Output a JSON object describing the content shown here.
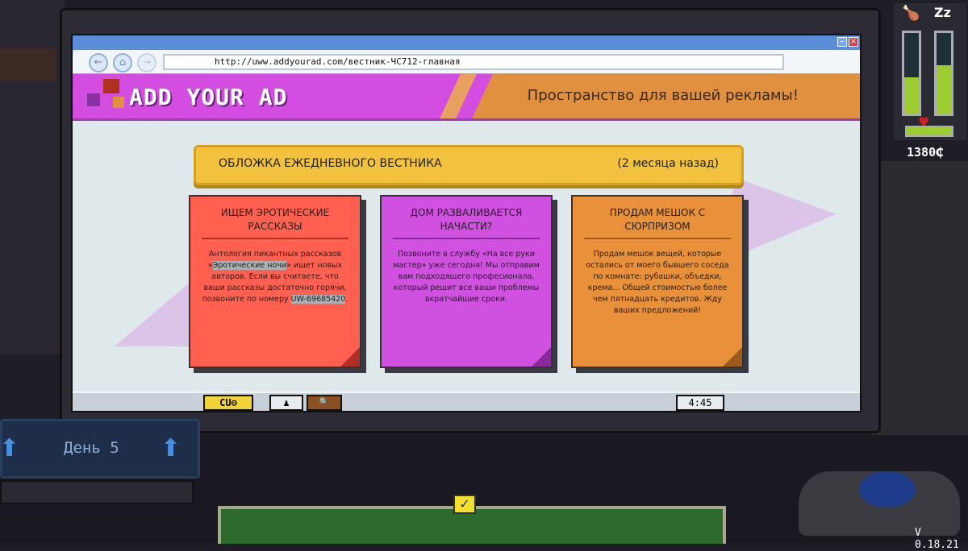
{
  "browser": {
    "url": "http://uww.addyourad.com/вестник-ЧС712-главная",
    "nav": {
      "back": "←",
      "home": "⌂",
      "forward": "→"
    },
    "window_controls": {
      "minimize": "–",
      "close": "×"
    }
  },
  "site": {
    "logo": "ADD YOUR AD",
    "slogan": "Пространство для вашей рекламы!",
    "colors": {
      "magenta": "#d24de0",
      "orange": "#e0903f"
    }
  },
  "banner": {
    "title": "ОБЛОЖКА ЕЖЕДНЕВНОГО ВЕСТНИКА",
    "date": "(2 месяца назад)"
  },
  "ads": [
    {
      "title": "ИЩЕМ ЭРОТИЧЕСКИЕ РАССКАЗЫ",
      "text_before": "Антология пикантных рассказов «",
      "highlight1": "Эротические ночи",
      "text_mid": "» ищет новых авторов. Если вы считаете, что ваши рассказы достаточно горячи, позвоните по номеру ",
      "highlight2": "UW-69685420",
      "text_end": ".",
      "color": "#ff6050"
    },
    {
      "title": "ДОМ РАЗВАЛИВАЕТСЯ НАЧАСТИ?",
      "text": "Позвоните в службу «На все руки мастер» уже сегодня! Мы отправим вам подходящего професионала, который решит все ваши проблемы вкратчайшие сроки.",
      "color": "#d050e0"
    },
    {
      "title": "ПРОДАМ МЕШОК С СЮРПРИЗОМ",
      "text": "Продам мешок вещей, которые остались от моего бывшего соседа по комнате: рубашки, объедки, крема... Общей стоимостью более чем пятнадцать кредитов. Жду ваших предложений!",
      "color": "#e8903a"
    }
  ],
  "taskbar": {
    "start": "CU⊖",
    "app1": "♟",
    "app2": "🔍",
    "clock": "4:45"
  },
  "hud": {
    "day": "День 5",
    "money": "1380₵",
    "version": "V 0.18.21",
    "hunger_level": 0.45,
    "sleep_level": 0.6,
    "confirm": "✓"
  }
}
